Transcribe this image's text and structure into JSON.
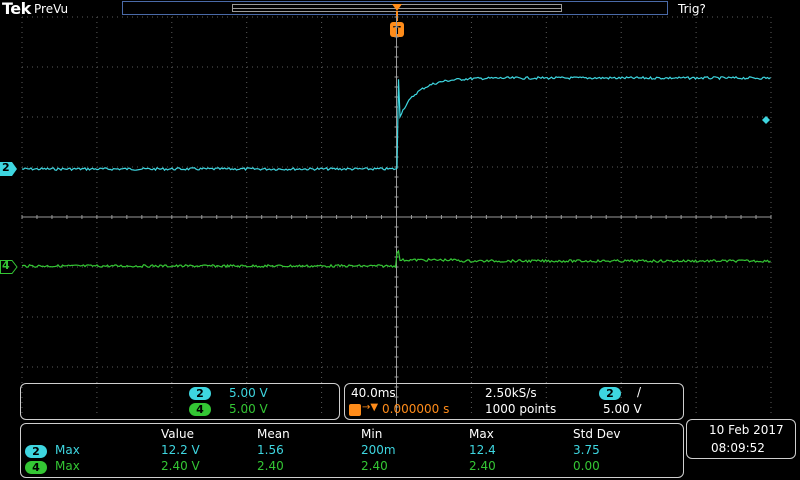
{
  "header": {
    "logo": "Tek",
    "acquisition_state": "PreVu",
    "trigger_status": "Trig?",
    "trigger_position_marker": "T"
  },
  "channels": [
    {
      "id": "2",
      "color": "#3ed6e0",
      "scale": "5.00 V"
    },
    {
      "id": "4",
      "color": "#34c634",
      "scale": "5.00 V"
    }
  ],
  "timebase": {
    "horizontal_scale": "40.0ms",
    "sample_rate": "2.50kS/s",
    "trigger_position": "0.000000 s",
    "record_length": "1000 points",
    "trigger_source": "2",
    "trigger_slope": "/",
    "trigger_level": "5.00 V"
  },
  "measurements": {
    "headers": [
      "Value",
      "Mean",
      "Min",
      "Max",
      "Std Dev"
    ],
    "rows": [
      {
        "channel": "2",
        "type": "Max",
        "value": "12.2 V",
        "mean": "1.56",
        "min": "200m",
        "max": "12.4",
        "std_dev": "3.75"
      },
      {
        "channel": "4",
        "type": "Max",
        "value": "2.40 V",
        "mean": "2.40",
        "min": "2.40",
        "max": "2.40",
        "std_dev": "0.00"
      }
    ]
  },
  "datetime": {
    "date": "10 Feb  2017",
    "time": "08:09:52"
  },
  "colors": {
    "cyan": "#3ed6e0",
    "green": "#34c634",
    "orange": "#ff8c1a",
    "grid": "#5a5a5a"
  }
}
